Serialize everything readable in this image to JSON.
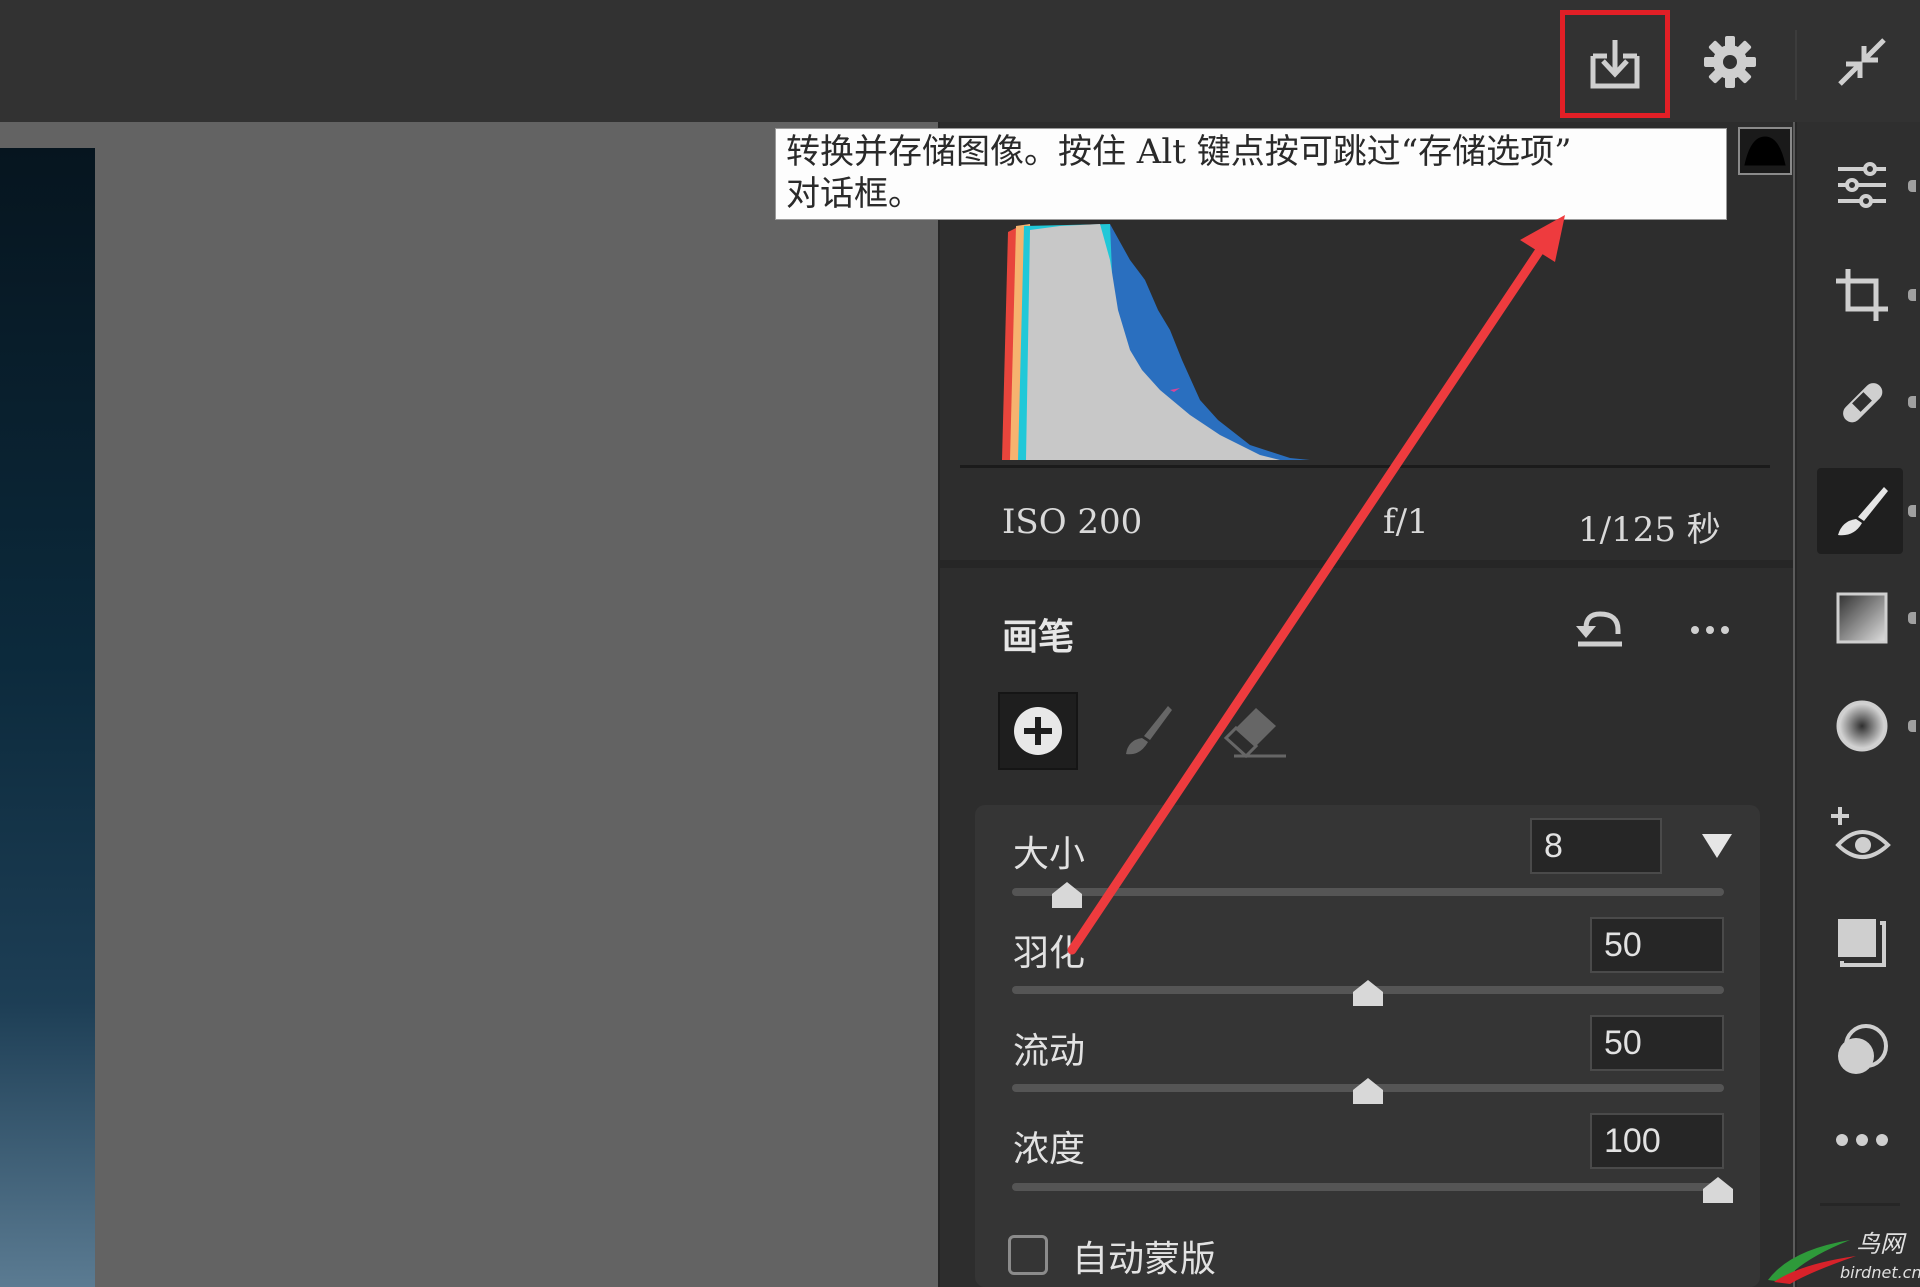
{
  "toolbar": {
    "save_icon": "save-download-icon",
    "settings_icon": "gear-icon",
    "collapse_icon": "collapse-arrows-icon"
  },
  "tooltip": {
    "text": "转换并存储图像。按住 Alt 键点按可跳过“存储选项”\n对话框。"
  },
  "histogram": {
    "clipping_indicator_icon": "shadow-clipping-icon"
  },
  "exif": {
    "iso": "ISO 200",
    "aperture": "f/1",
    "shutter": "1/125 秒"
  },
  "brush_panel": {
    "title": "画笔",
    "reset_icon": "reset-icon",
    "more_icon": "more-dots-icon",
    "modes": [
      "add-icon",
      "brush-icon",
      "eraser-icon"
    ],
    "sliders": [
      {
        "label": "大小",
        "value": "8",
        "fraction": 0.07,
        "has_dropdown": true
      },
      {
        "label": "羽化",
        "value": "50",
        "fraction": 0.5
      },
      {
        "label": "流动",
        "value": "50",
        "fraction": 0.5
      },
      {
        "label": "浓度",
        "value": "100",
        "fraction": 1.0
      }
    ],
    "auto_mask_label": "自动蒙版",
    "auto_mask_checked": false
  },
  "right_toolbar": {
    "items": [
      {
        "icon": "edit-sliders-icon",
        "active": false
      },
      {
        "icon": "crop-icon",
        "active": false
      },
      {
        "icon": "healing-bandage-icon",
        "active": false
      },
      {
        "icon": "masking-brush-icon",
        "active": true
      },
      {
        "icon": "linear-gradient-icon",
        "active": false
      },
      {
        "icon": "radial-filter-icon",
        "active": false
      },
      {
        "icon": "red-eye-icon",
        "active": false
      },
      {
        "icon": "snapshots-icon",
        "active": false
      },
      {
        "icon": "presets-icon",
        "active": false
      },
      {
        "icon": "more-dots-icon",
        "active": false
      }
    ]
  },
  "watermark": {
    "text_cn": "鸟网",
    "text_en": "birdnet.cn"
  },
  "colors": {
    "highlight_border": "#e21f26",
    "annotation_arrow": "#ee3b3e"
  }
}
